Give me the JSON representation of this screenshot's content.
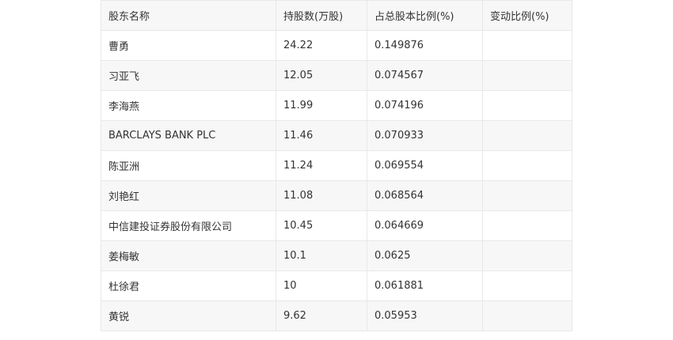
{
  "table": {
    "headers": [
      "股东名称",
      "持股数(万股)",
      "占总股本比例(%)",
      "变动比例(%)"
    ],
    "rows": [
      [
        "曹勇",
        "24.22",
        "0.149876",
        ""
      ],
      [
        "习亚飞",
        "12.05",
        "0.074567",
        ""
      ],
      [
        "李海燕",
        "11.99",
        "0.074196",
        ""
      ],
      [
        "BARCLAYS BANK PLC",
        "11.46",
        "0.070933",
        ""
      ],
      [
        "陈亚洲",
        "11.24",
        "0.069554",
        ""
      ],
      [
        "刘艳红",
        "11.08",
        "0.068564",
        ""
      ],
      [
        "中信建投证券股份有限公司",
        "10.45",
        "0.064669",
        ""
      ],
      [
        "姜梅敏",
        "10.1",
        "0.0625",
        ""
      ],
      [
        "杜徐君",
        "10",
        "0.061881",
        ""
      ],
      [
        "黄锐",
        "9.62",
        "0.05953",
        ""
      ]
    ]
  }
}
